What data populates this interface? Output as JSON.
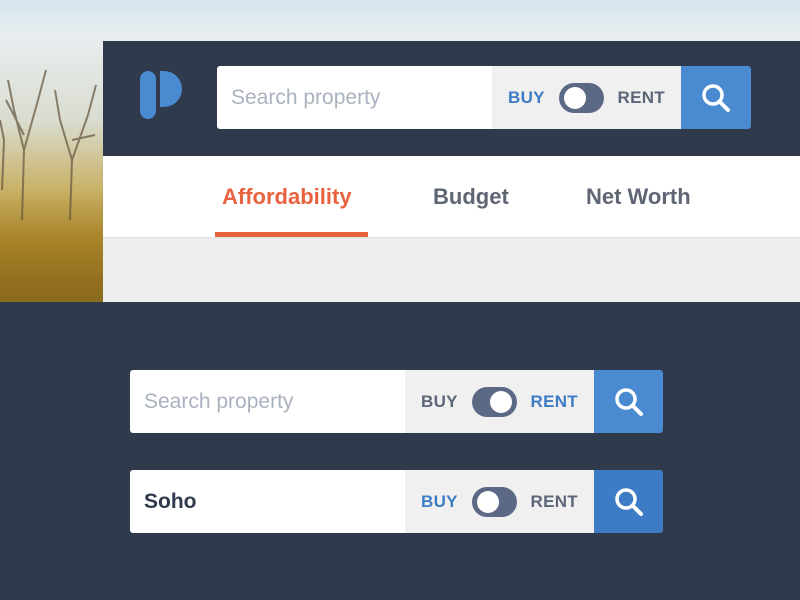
{
  "header": {
    "search": {
      "placeholder": "Search property",
      "value": ""
    },
    "toggle": {
      "buy_label": "BUY",
      "rent_label": "RENT",
      "selected": "buy"
    }
  },
  "tabs": [
    {
      "label": "Affordability",
      "active": true
    },
    {
      "label": "Budget",
      "active": false
    },
    {
      "label": "Net Worth",
      "active": false
    }
  ],
  "variant_rent": {
    "search": {
      "placeholder": "Search property",
      "value": ""
    },
    "toggle": {
      "buy_label": "BUY",
      "rent_label": "RENT",
      "selected": "rent"
    }
  },
  "variant_filled": {
    "search": {
      "placeholder": "Search property",
      "value": "Soho"
    },
    "toggle": {
      "buy_label": "BUY",
      "rent_label": "RENT",
      "selected": "buy"
    }
  },
  "colors": {
    "navy": "#2f3a4c",
    "accent_blue": "#3d7cc4",
    "search_button": "#4a8ad0",
    "tab_active": "#e8633f",
    "toggle_track": "#5c6985"
  },
  "icons": {
    "logo": "p-logo-icon",
    "search": "search-icon"
  }
}
